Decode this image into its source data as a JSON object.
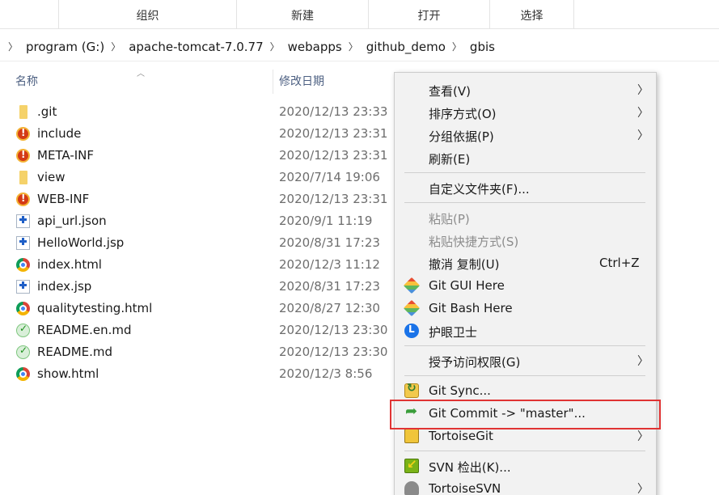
{
  "ribbon": {
    "groups": [
      "组织",
      "新建",
      "打开",
      "选择"
    ]
  },
  "address_bar": {
    "crumbs": [
      "program (G:)",
      "apache-tomcat-7.0.77",
      "webapps",
      "github_demo",
      "gbis"
    ]
  },
  "columns": {
    "name": "名称",
    "modified": "修改日期"
  },
  "files": [
    {
      "name": ".git",
      "date": "2020/12/13 23:33",
      "icon": "folder-icon"
    },
    {
      "name": "include",
      "date": "2020/12/13 23:31",
      "icon": "conflict-folder-icon"
    },
    {
      "name": "META-INF",
      "date": "2020/12/13 23:31",
      "icon": "conflict-folder-icon"
    },
    {
      "name": "view",
      "date": "2020/7/14 19:06",
      "icon": "folder-icon"
    },
    {
      "name": "WEB-INF",
      "date": "2020/12/13 23:31",
      "icon": "conflict-folder-icon"
    },
    {
      "name": "api_url.json",
      "date": "2020/9/1 11:19",
      "icon": "added-file-icon"
    },
    {
      "name": "HelloWorld.jsp",
      "date": "2020/8/31 17:23",
      "icon": "added-file-icon"
    },
    {
      "name": "index.html",
      "date": "2020/12/3 11:12",
      "icon": "chrome-html-icon"
    },
    {
      "name": "index.jsp",
      "date": "2020/8/31 17:23",
      "icon": "added-file-icon"
    },
    {
      "name": "qualitytesting.html",
      "date": "2020/8/27 12:30",
      "icon": "chrome-html-icon"
    },
    {
      "name": "README.en.md",
      "date": "2020/12/13 23:30",
      "icon": "normal-file-icon"
    },
    {
      "name": "README.md",
      "date": "2020/12/13 23:30",
      "icon": "normal-file-icon"
    },
    {
      "name": "show.html",
      "date": "2020/12/3 8:56",
      "icon": "chrome-html-icon"
    }
  ],
  "context_menu": {
    "view": "查看(V)",
    "sort_by": "排序方式(O)",
    "group_by": "分组依据(P)",
    "refresh": "刷新(E)",
    "customize_folder": "自定义文件夹(F)...",
    "paste": "粘贴(P)",
    "paste_shortcut": "粘贴快捷方式(S)",
    "undo_copy": "撤消 复制(U)",
    "undo_copy_shortcut": "Ctrl+Z",
    "git_gui": "Git GUI Here",
    "git_bash": "Git Bash Here",
    "eye_guard": "护眼卫士",
    "give_access": "授予访问权限(G)",
    "git_sync": "Git Sync...",
    "git_commit": "Git Commit -> \"master\"...",
    "tortoise_git": "TortoiseGit",
    "svn_checkout": "SVN 检出(K)...",
    "tortoise_svn": "TortoiseSVN",
    "submenu_glyph": "〉",
    "highlight_color": "#e03333"
  }
}
